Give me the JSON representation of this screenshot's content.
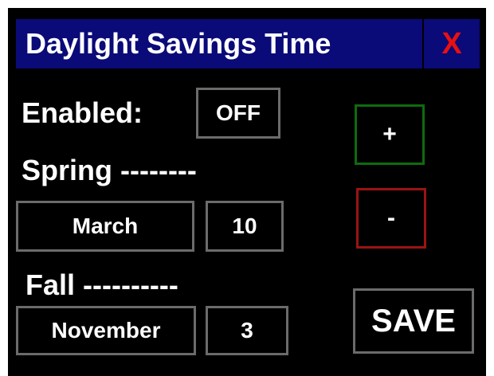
{
  "window": {
    "title": "Daylight Savings Time",
    "close_label": "X"
  },
  "enabled": {
    "label": "Enabled:",
    "value": "OFF"
  },
  "spring": {
    "label": "Spring --------",
    "month": "March",
    "day": "10"
  },
  "fall": {
    "label": "Fall ----------",
    "month": "November",
    "day": "3"
  },
  "controls": {
    "increment_label": "+",
    "decrement_label": "-",
    "save_label": "SAVE"
  },
  "colors": {
    "background": "#000000",
    "title_bar": "#0a0a78",
    "close": "#e81010",
    "plus_border": "#0e6b0e",
    "minus_border": "#9a1414",
    "box_border": "#6b6b6b"
  }
}
